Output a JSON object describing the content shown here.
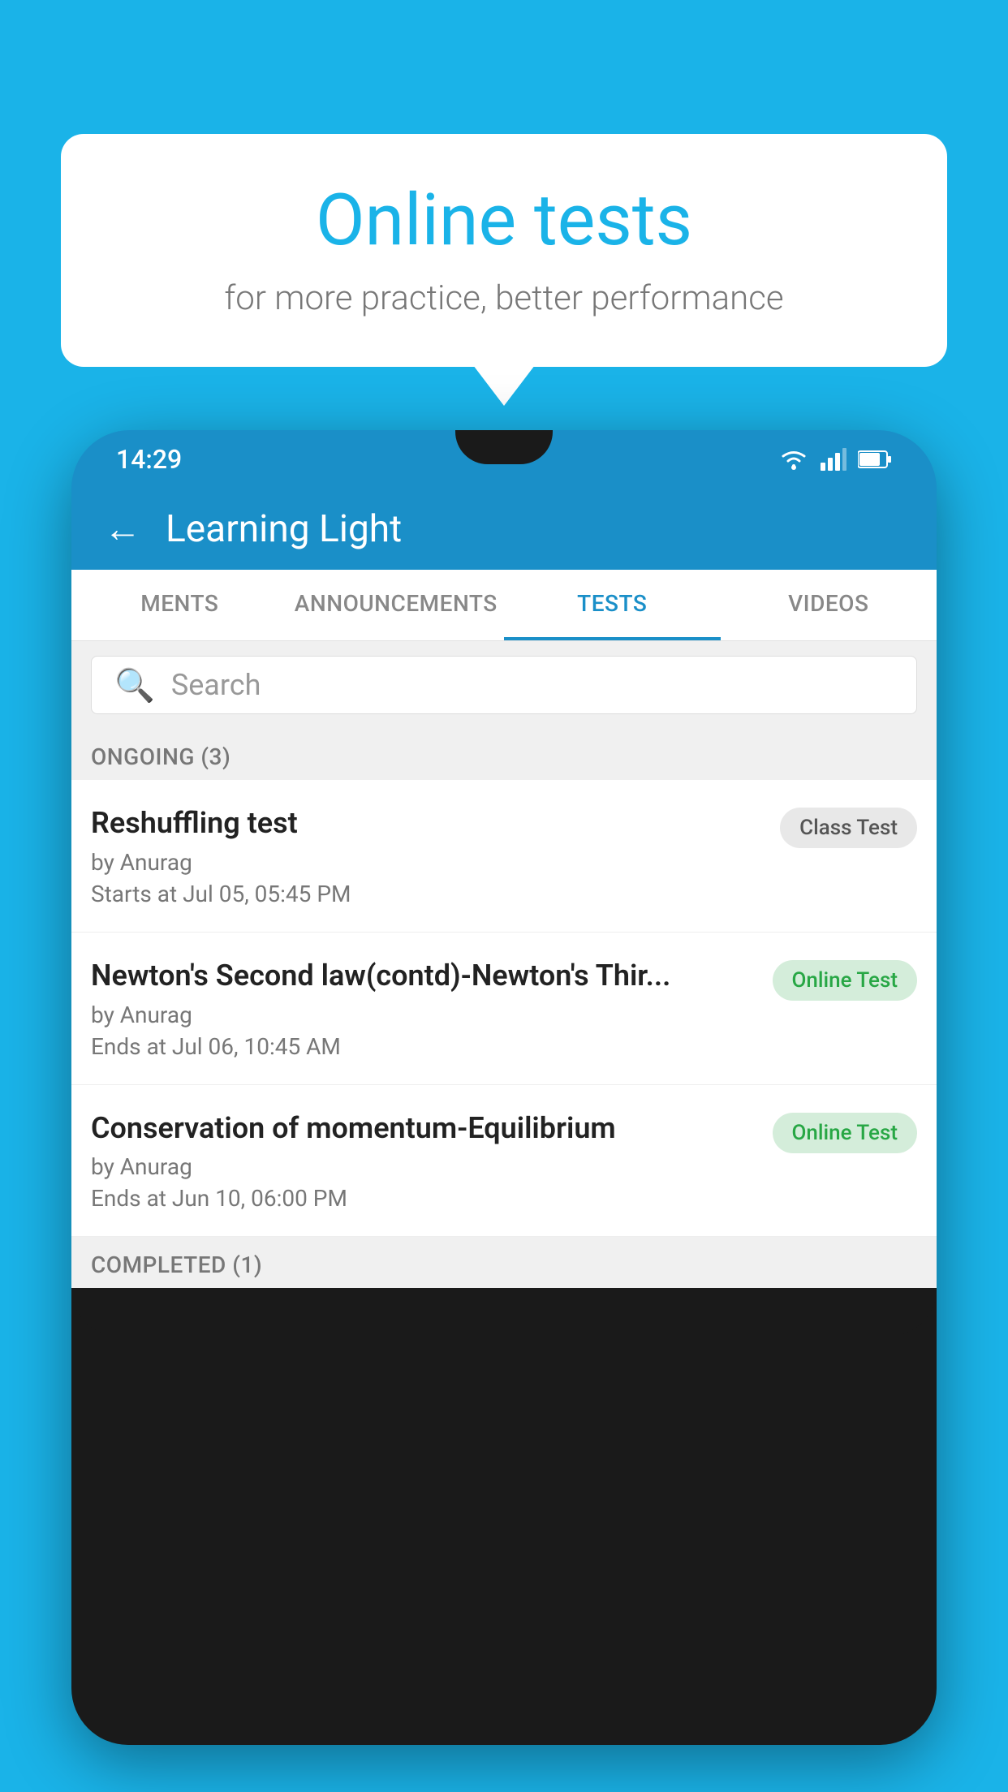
{
  "background": {
    "color": "#1ab3e8"
  },
  "speech_bubble": {
    "title": "Online tests",
    "subtitle": "for more practice, better performance"
  },
  "status_bar": {
    "time": "14:29"
  },
  "app_header": {
    "title": "Learning Light",
    "back_label": "←"
  },
  "tabs": [
    {
      "label": "MENTS",
      "active": false
    },
    {
      "label": "ANNOUNCEMENTS",
      "active": false
    },
    {
      "label": "TESTS",
      "active": true
    },
    {
      "label": "VIDEOS",
      "active": false
    }
  ],
  "search": {
    "placeholder": "Search"
  },
  "ongoing_section": {
    "label": "ONGOING (3)"
  },
  "test_items": [
    {
      "name": "Reshuffling test",
      "by": "by Anurag",
      "date": "Starts at  Jul 05, 05:45 PM",
      "badge": "Class Test",
      "badge_type": "class"
    },
    {
      "name": "Newton's Second law(contd)-Newton's Thir...",
      "by": "by Anurag",
      "date": "Ends at  Jul 06, 10:45 AM",
      "badge": "Online Test",
      "badge_type": "online"
    },
    {
      "name": "Conservation of momentum-Equilibrium",
      "by": "by Anurag",
      "date": "Ends at  Jun 10, 06:00 PM",
      "badge": "Online Test",
      "badge_type": "online"
    }
  ],
  "completed_section": {
    "label": "COMPLETED (1)"
  }
}
